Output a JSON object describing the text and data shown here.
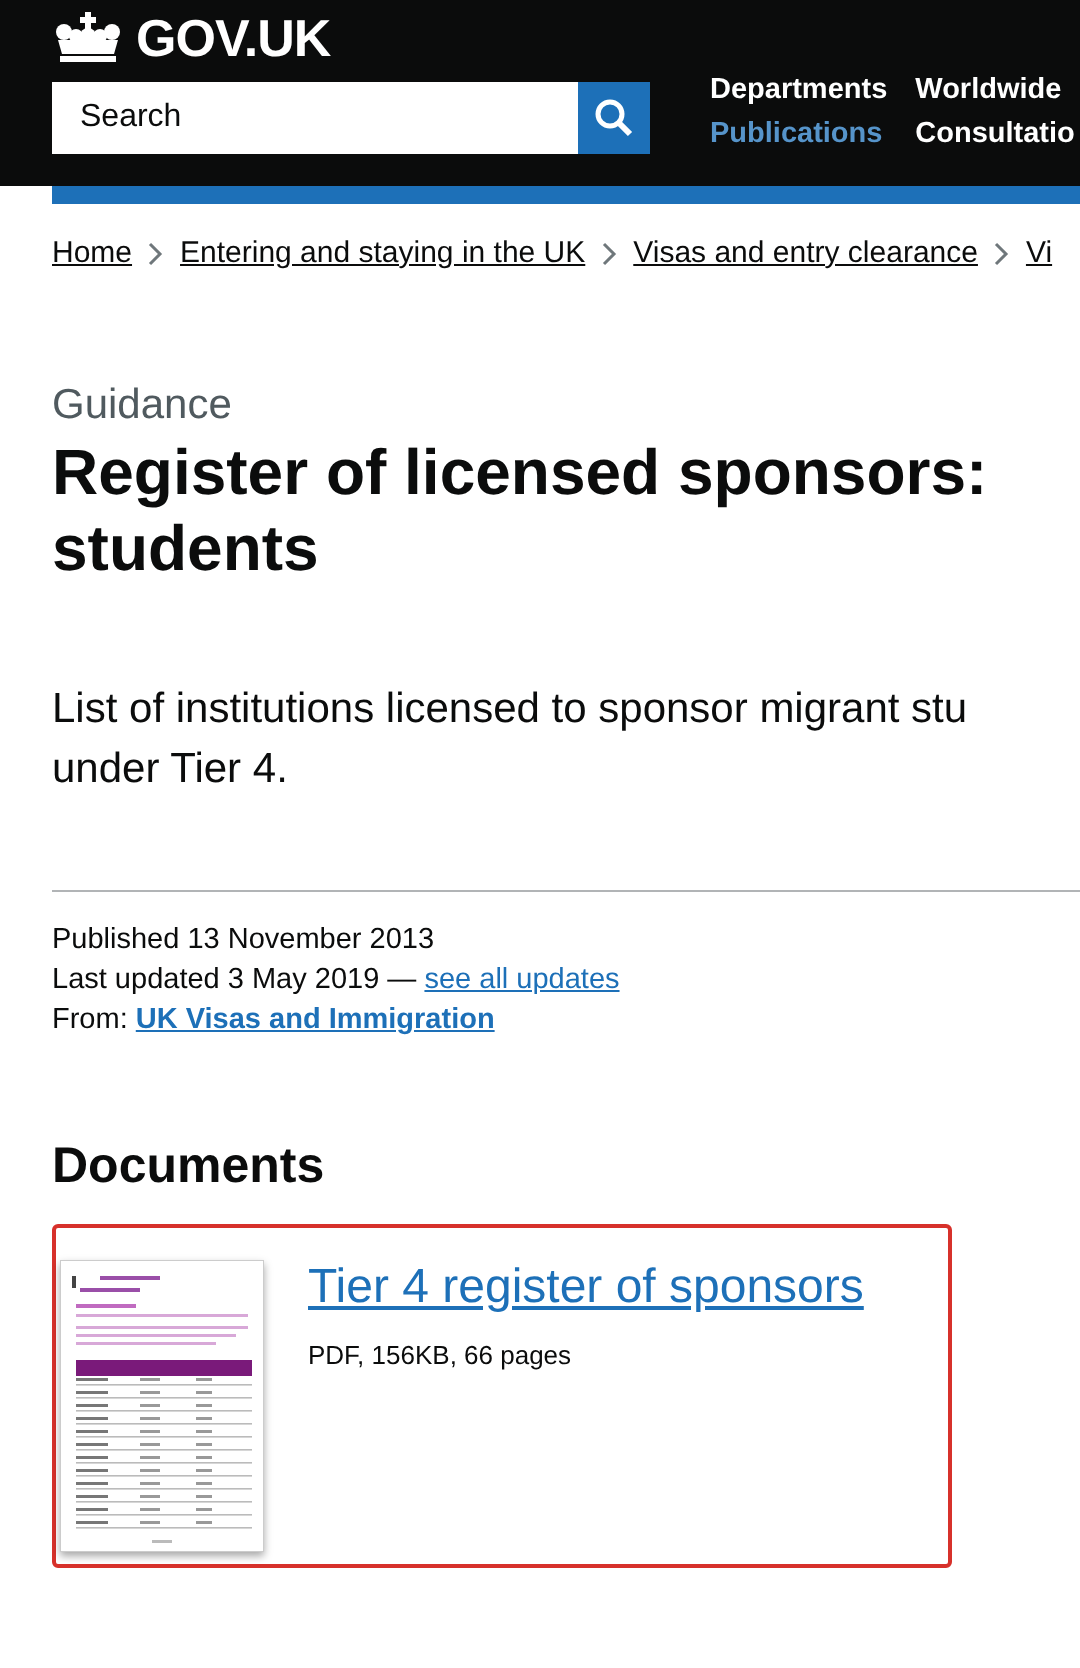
{
  "header": {
    "logo": "GOV.UK",
    "search": {
      "placeholder": "Search"
    },
    "nav": [
      {
        "label": "Departments",
        "selected": false
      },
      {
        "label": "Worldwide",
        "selected": false
      },
      {
        "label": "Publications",
        "selected": true
      },
      {
        "label": "Consultatio",
        "selected": false
      }
    ]
  },
  "breadcrumbs": [
    "Home",
    "Entering and staying in the UK",
    "Visas and entry clearance",
    "Vi"
  ],
  "caption": "Guidance",
  "title": "Register of licensed sponsors: students",
  "lede_lines": [
    "List of institutions licensed to sponsor migrant stu",
    "under Tier 4."
  ],
  "metadata": {
    "published": "Published 13 November 2013",
    "updated": "Last updated 3 May 2019 —",
    "updates_link": "see all updates",
    "from_label": "From:",
    "from_link": "UK Visas and Immigration"
  },
  "documents": {
    "heading": "Documents",
    "items": [
      {
        "title": "Tier 4 register of sponsors",
        "details": "PDF, 156KB, 66 pages"
      }
    ]
  }
}
